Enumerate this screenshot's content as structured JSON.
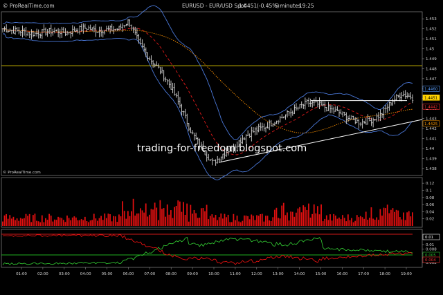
{
  "header": {
    "brand": "© ProRealTime.com",
    "title": "EURUSD - EUR/USD Spot",
    "last_price": "1.4451",
    "change": "(-0.45%)",
    "interval": "5 minutes",
    "time": "19:25"
  },
  "watermark": "trading-for-freedom.blogspot.com",
  "footer_brand": "© ProRealTime.com",
  "chart_data": [
    {
      "type": "line",
      "name": "price",
      "x": [
        "00:00",
        "00:30",
        "01:00",
        "01:30",
        "02:00",
        "02:30",
        "03:00",
        "03:30",
        "04:00",
        "04:30",
        "05:00",
        "05:30",
        "06:00",
        "06:30",
        "07:00",
        "07:30",
        "08:00",
        "08:30",
        "09:00",
        "09:30",
        "10:00",
        "10:30",
        "11:00",
        "11:30",
        "12:00",
        "12:30",
        "13:00",
        "13:30",
        "14:00",
        "14:30",
        "15:00",
        "15:30",
        "16:00",
        "16:30",
        "17:00",
        "17:30",
        "18:00",
        "18:30",
        "19:00",
        "19:25"
      ],
      "close": [
        1.452,
        1.4518,
        1.4517,
        1.4515,
        1.4517,
        1.4518,
        1.4516,
        1.4519,
        1.4521,
        1.4518,
        1.4519,
        1.452,
        1.4528,
        1.4505,
        1.449,
        1.4478,
        1.4462,
        1.444,
        1.4415,
        1.44,
        1.4385,
        1.4395,
        1.4402,
        1.4412,
        1.4418,
        1.4422,
        1.4428,
        1.4434,
        1.444,
        1.4446,
        1.4444,
        1.444,
        1.4436,
        1.443,
        1.4426,
        1.4428,
        1.4434,
        1.4447,
        1.4455,
        1.4451
      ],
      "yticks": [
        1.438,
        1.439,
        1.44,
        1.441,
        1.442,
        1.443,
        1.444,
        1.445,
        1.446,
        1.447,
        1.448,
        1.449,
        1.45,
        1.451,
        1.452,
        1.453
      ],
      "ylim": [
        1.4375,
        1.4535
      ],
      "price_labels": [
        {
          "text": "1.4460",
          "value": 1.446,
          "color": "#5aa0ff"
        },
        {
          "text": "1.4451",
          "value": 1.4451,
          "color": "#ffd200"
        },
        {
          "text": "1.4442",
          "value": 1.4442,
          "color": "#ff3030"
        },
        {
          "text": "1.4425",
          "value": 1.4425,
          "color": "#ff9a00"
        }
      ],
      "horizontal_line": 1.4483,
      "overlays": [
        "Bollinger bands (blue)",
        "moving average (red dashed)",
        "moving average (orange dotted)"
      ]
    },
    {
      "type": "bar",
      "name": "volume",
      "yticks": [
        0.02,
        0.04,
        0.06,
        0.08,
        0.1,
        0.12
      ],
      "ylim": [
        0,
        0.13
      ],
      "color": "#e01010"
    },
    {
      "type": "line",
      "name": "oscillator",
      "yticks": [
        0.002,
        0.004,
        0.006,
        0.008,
        0.01
      ],
      "highlight_labels": [
        {
          "text": "0.01",
          "color": "#ffffff"
        },
        {
          "text": "0.005",
          "color": "#30c030"
        },
        {
          "text": "0.004",
          "color": "#ff3030"
        }
      ],
      "series": [
        {
          "color": "#30c030"
        },
        {
          "color": "#e01010"
        }
      ]
    }
  ],
  "x_axis": {
    "labels": [
      "01:00",
      "02:00",
      "03:00",
      "04:00",
      "05:00",
      "06:00",
      "07:00",
      "08:00",
      "09:00",
      "10:00",
      "11:00",
      "12:00",
      "13:00",
      "14:00",
      "15:00",
      "16:00",
      "17:00",
      "18:00",
      "19:00"
    ]
  }
}
